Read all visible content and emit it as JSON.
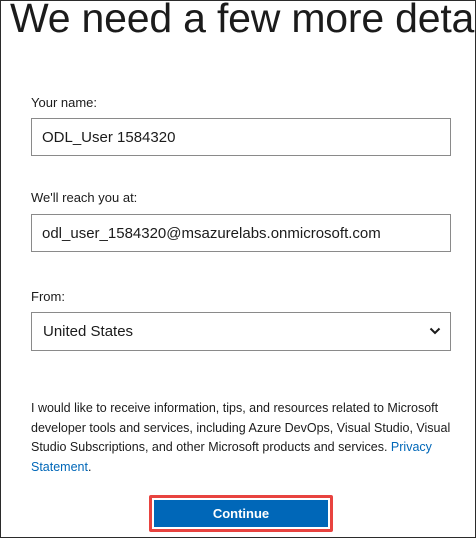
{
  "page": {
    "title": "We need a few more details"
  },
  "form": {
    "name_label": "Your name:",
    "name_value": "ODL_User 1584320",
    "email_label": "We'll reach you at:",
    "email_value": "odl_user_1584320@msazurelabs.onmicrosoft.com",
    "country_label": "From:",
    "country_value": "United States",
    "country_icon": "chevron-down-icon"
  },
  "consent": {
    "text": "I would like to receive information, tips, and resources related to Microsoft developer tools and services, including Azure DevOps, Visual Studio, Visual Studio Subscriptions, and other Microsoft products and services.",
    "link_text": "Privacy Statement",
    "after_link": "."
  },
  "actions": {
    "continue_label": "Continue"
  },
  "colors": {
    "accent": "#0067b8",
    "highlight": "#e8433f",
    "text": "#1b1b1b"
  }
}
